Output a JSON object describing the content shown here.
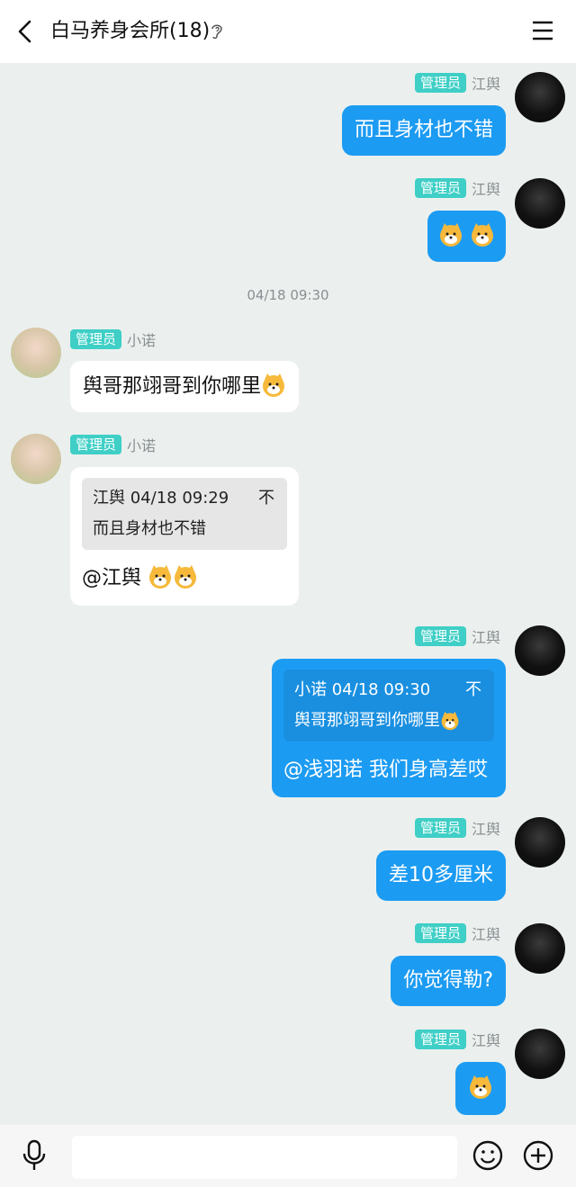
{
  "header": {
    "title": "白马养身会所(18)",
    "back_icon": "chevron-left-icon",
    "ear_icon": "ear-icon",
    "menu_icon": "menu-icon"
  },
  "timestamp": "04/18 09:30",
  "messages": [
    {
      "side": "me",
      "badge": "管理员",
      "sender": "江舆",
      "text": "而且身材也不错"
    },
    {
      "side": "me",
      "badge": "管理员",
      "sender": "江舆",
      "emoji": "dog-emoji x2"
    },
    {
      "side": "her",
      "badge": "管理员",
      "sender": "小诺",
      "text": "舆哥那翊哥到你哪里"
    },
    {
      "side": "her",
      "badge": "管理员",
      "sender": "小诺",
      "quote": {
        "header": "江舆 04/18 09:29",
        "text": "而且身材也不错",
        "close": "不"
      },
      "text": "@江舆"
    },
    {
      "side": "me",
      "badge": "管理员",
      "sender": "江舆",
      "quote": {
        "header": "小诺 04/18 09:30",
        "text": "舆哥那翊哥到你哪里",
        "close": "不"
      },
      "text": "@浅羽诺 我们身高差哎"
    },
    {
      "side": "me",
      "badge": "管理员",
      "sender": "江舆",
      "text": "差10多厘米"
    },
    {
      "side": "me",
      "badge": "管理员",
      "sender": "江舆",
      "text": "你觉得勒?"
    },
    {
      "side": "me",
      "badge": "管理员",
      "sender": "江舆",
      "emoji": "dog-emoji"
    }
  ],
  "input": {
    "placeholder": ""
  },
  "colors": {
    "accent": "#1c9bf2",
    "badge": "#3fcfc6",
    "background": "#ebf0ee"
  }
}
